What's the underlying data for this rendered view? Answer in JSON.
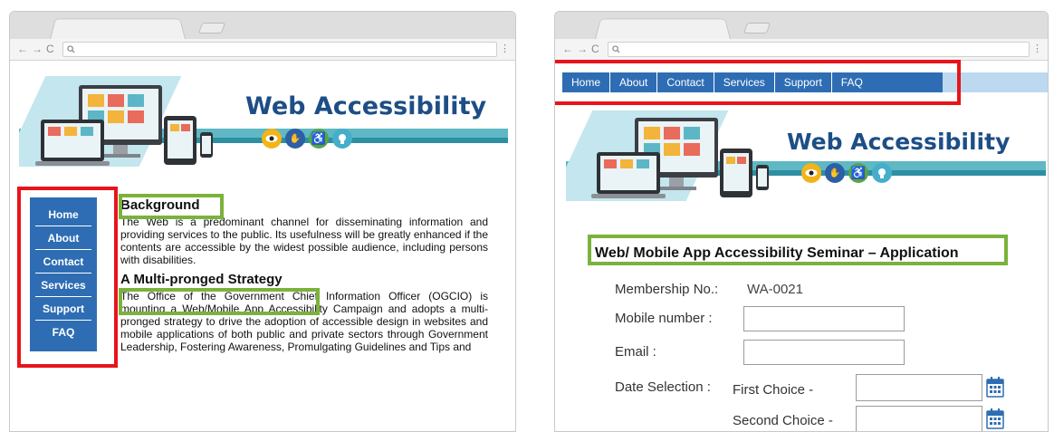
{
  "browser": {
    "back": "←",
    "forward": "→",
    "reload": "C",
    "menu": "⋮"
  },
  "left_page": {
    "banner": {
      "title": "Web Accessibility",
      "icons": [
        "eye-icon",
        "sign-language-icon",
        "wheelchair-icon",
        "head-icon"
      ]
    },
    "nav": {
      "items": [
        "Home",
        "About",
        "Contact",
        "Services",
        "Support",
        "FAQ"
      ]
    },
    "sections": [
      {
        "heading": "Background",
        "text": "The Web is a predominant channel for disseminating information and providing services to the public. Its usefulness will be greatly enhanced if the contents are accessible by the widest possible audience, including persons with disabilities."
      },
      {
        "heading": "A Multi-pronged Strategy",
        "text": "The Office of the Government Chief Information Officer (OGCIO) is mounting a Web/Mobile App Accessibility Campaign and adopts a multi-pronged strategy to drive the adoption of accessible design in websites and mobile applications of both public and private sectors through Government Leadership, Fostering Awareness, Promulgating Guidelines and Tips and"
      }
    ]
  },
  "right_page": {
    "nav": {
      "items": [
        "Home",
        "About",
        "Contact",
        "Services",
        "Support",
        "FAQ"
      ]
    },
    "banner": {
      "title": "Web Accessibility"
    },
    "form": {
      "title": "Web/ Mobile App Accessibility Seminar – Application",
      "membership_label": "Membership No.:",
      "membership_value": "WA-0021",
      "mobile_label": "Mobile number :",
      "email_label": "Email :",
      "date_label": "Date Selection :",
      "first_choice_label": "First Choice -",
      "second_choice_label": "Second Choice -"
    }
  },
  "colors": {
    "nav_blue": "#2e6db3",
    "highlight_red": "#e8141b",
    "highlight_green": "#7ab23c",
    "banner_teal": "#4aa8b8",
    "title_blue": "#1d4e86"
  }
}
